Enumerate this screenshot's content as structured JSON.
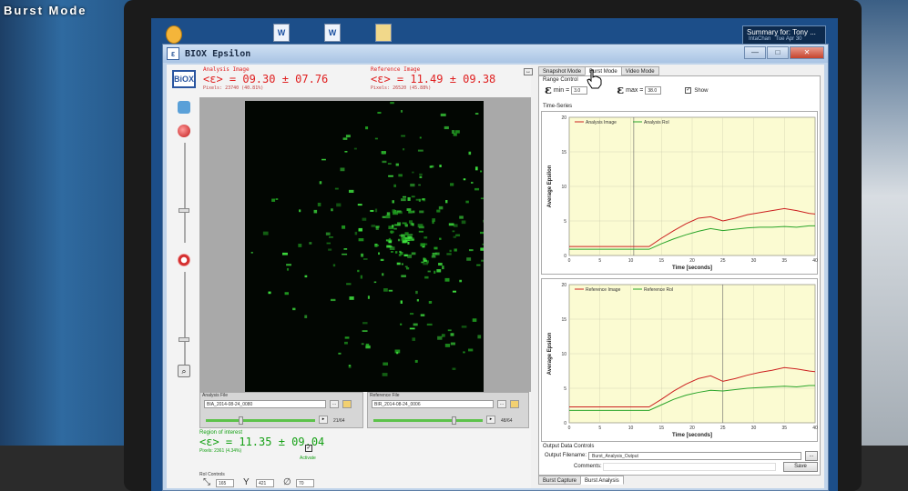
{
  "caption": "Burst Mode",
  "notification": {
    "title": "Summary for: Tony ...",
    "from": "IntaChan",
    "date": "Tue Apr 30"
  },
  "window": {
    "title": "BIOX Epsilon",
    "logo": "BiOX"
  },
  "analysis": {
    "label": "Analysis Image",
    "value": "<ε> = 09.30 ± 07.76",
    "pixels": "Pixels:   23740 (40.81%)",
    "file_label": "Analysis File",
    "file_name": "BIA_2014-08-24_0080",
    "frame_count": "21/64"
  },
  "reference": {
    "label": "Reference Image",
    "value": "<ε> = 11.49 ± 09.38",
    "pixels": "Pixels:   26520 (45.88%)",
    "file_label": "Reference File",
    "file_name": "BIR_2014-08-24_0006",
    "frame_count": "48/64"
  },
  "roi": {
    "label": "Region of interest",
    "value": "<ε> = 11.35 ± 09.04",
    "pixels": "Pixels:   2361 (4.34%)",
    "activate": "Activate",
    "controls_label": "RoI Controls",
    "x": "165",
    "y": "421",
    "r": "70"
  },
  "tabs": {
    "snapshot": "Snapshot Mode",
    "burst": "Burst Mode",
    "video": "Video Mode"
  },
  "range": {
    "title": "Range Control",
    "min_label": "min =",
    "min_value": "3.0",
    "max_label": "max =",
    "max_value": "38.0",
    "show": "Show"
  },
  "time_series_label": "Time-Series",
  "colors": {
    "analysis": "#cc2020",
    "roi": "#2aa52a",
    "plot_bg": "#fbfbd2"
  },
  "chart_data": [
    {
      "type": "line",
      "title": "",
      "xlabel": "Time [seconds]",
      "ylabel": "Average Epsilon",
      "xlim": [
        0,
        40
      ],
      "ylim": [
        0,
        20
      ],
      "xticks": [
        "0",
        "5",
        "10",
        "15",
        "20",
        "25",
        "30",
        "35",
        "40"
      ],
      "yticks": [
        "0",
        "5",
        "10",
        "15",
        "20"
      ],
      "marker_x": 10.5,
      "series": [
        {
          "name": "Analysis Image",
          "color": "#cc2020",
          "x": [
            0,
            5,
            10,
            13,
            15,
            17,
            19,
            21,
            23,
            25,
            27,
            29,
            31,
            33,
            35,
            37,
            39,
            40
          ],
          "y": [
            1.3,
            1.3,
            1.3,
            1.3,
            2.5,
            3.6,
            4.6,
            5.4,
            5.6,
            5.0,
            5.4,
            5.9,
            6.2,
            6.5,
            6.8,
            6.5,
            6.1,
            6.0
          ]
        },
        {
          "name": "Analysis RoI",
          "color": "#2aa52a",
          "x": [
            0,
            5,
            10,
            13,
            15,
            17,
            19,
            21,
            23,
            25,
            27,
            29,
            31,
            33,
            35,
            37,
            39,
            40
          ],
          "y": [
            0.9,
            0.9,
            0.9,
            0.9,
            1.7,
            2.4,
            3.0,
            3.5,
            3.9,
            3.6,
            3.8,
            4.0,
            4.1,
            4.1,
            4.2,
            4.1,
            4.3,
            4.3
          ]
        }
      ]
    },
    {
      "type": "line",
      "title": "",
      "xlabel": "Time [seconds]",
      "ylabel": "Average Epsilon",
      "xlim": [
        0,
        40
      ],
      "ylim": [
        0,
        20
      ],
      "xticks": [
        "0",
        "5",
        "10",
        "15",
        "20",
        "25",
        "30",
        "35",
        "40"
      ],
      "yticks": [
        "0",
        "5",
        "10",
        "15",
        "20"
      ],
      "marker_x": 25,
      "series": [
        {
          "name": "Reference Image",
          "color": "#cc2020",
          "x": [
            0,
            5,
            10,
            13,
            15,
            17,
            19,
            21,
            23,
            25,
            27,
            29,
            31,
            33,
            35,
            37,
            39,
            40
          ],
          "y": [
            2.3,
            2.3,
            2.3,
            2.3,
            3.4,
            4.6,
            5.6,
            6.4,
            6.8,
            6.0,
            6.4,
            6.9,
            7.3,
            7.6,
            8.0,
            7.8,
            7.5,
            7.4
          ]
        },
        {
          "name": "Reference RoI",
          "color": "#2aa52a",
          "x": [
            0,
            5,
            10,
            13,
            15,
            17,
            19,
            21,
            23,
            25,
            27,
            29,
            31,
            33,
            35,
            37,
            39,
            40
          ],
          "y": [
            1.8,
            1.8,
            1.8,
            1.8,
            2.6,
            3.4,
            4.0,
            4.4,
            4.7,
            4.6,
            4.8,
            5.0,
            5.1,
            5.2,
            5.3,
            5.2,
            5.4,
            5.4
          ]
        }
      ]
    }
  ],
  "output": {
    "title": "Output Data Controls",
    "filename_label": "Output Filename:",
    "filename_value": "Burst_Analysis_Output",
    "comments_label": "Comments:",
    "browse": "...",
    "save": "Save"
  },
  "bottom_tabs": {
    "capture": "Burst Capture",
    "analysis": "Burst Analysis"
  }
}
